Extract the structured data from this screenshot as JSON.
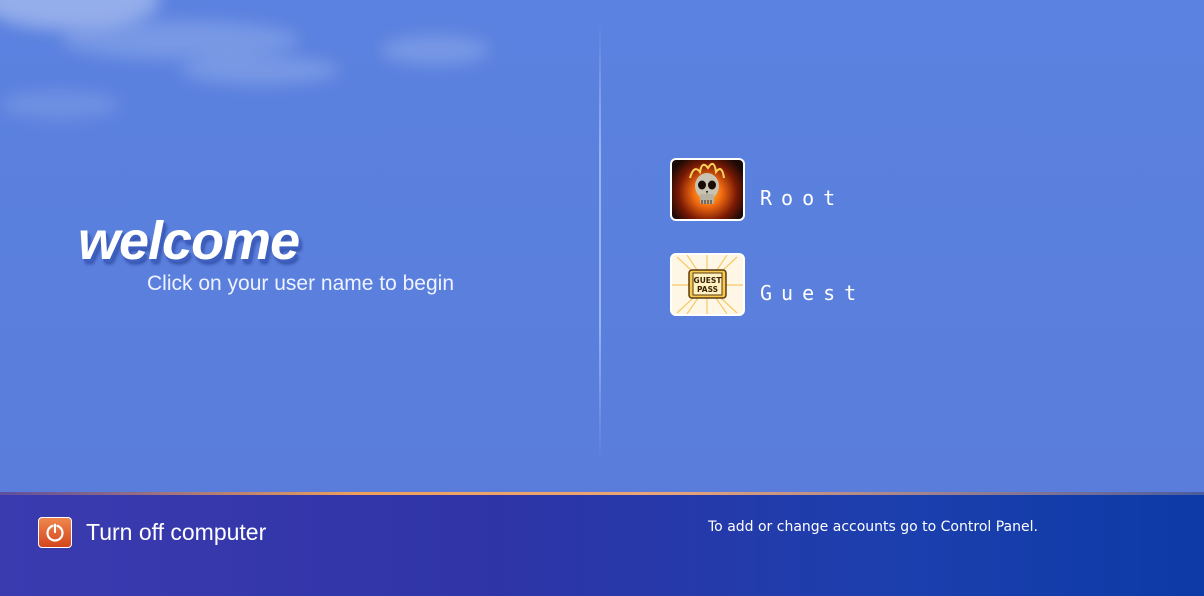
{
  "welcome": {
    "title": "welcome",
    "subtitle": "Click on your user name to begin"
  },
  "users": [
    {
      "name": "Root",
      "avatar": "flaming-skull-icon"
    },
    {
      "name": "Guest",
      "avatar": "guest-pass-icon",
      "avatar_text": [
        "GUEST",
        "PASS"
      ]
    }
  ],
  "footer": {
    "turn_off_label": "Turn off computer",
    "power_icon": "power-icon",
    "hint": "To add or change accounts go to Control Panel."
  },
  "colors": {
    "background": "#5b7fdc",
    "footer": "#2f34a6",
    "accent_line": "#f0a05a",
    "power_button": "#e2602e"
  }
}
